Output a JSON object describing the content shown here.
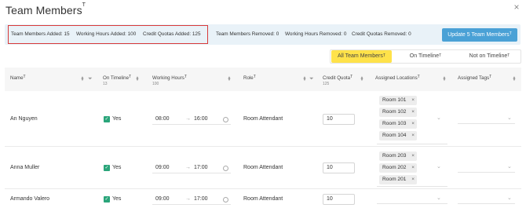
{
  "header": {
    "title": "Team Members",
    "title_mark": "T",
    "close_icon": "close-icon"
  },
  "summary": {
    "added": {
      "team_members": "Team Members Added: 15",
      "working_hours": "Working Hours Added: 100",
      "credit_quotas": "Credit Quotas Added: 125"
    },
    "removed": {
      "team_members": "Team Members Removed: 0",
      "working_hours": "Working Hours Removed: 0",
      "credit_quotas": "Credit Quotas Removed: 0"
    },
    "update_button": "Update 5 Team Members",
    "update_mark": "T",
    "highlight_color": "#d83a3a",
    "accent_color": "#4aa1d6"
  },
  "filters": {
    "tabs": [
      {
        "label": "All Team Members",
        "mark": "T",
        "active": true
      },
      {
        "label": "On Timeline",
        "mark": "T",
        "active": false
      },
      {
        "label": "Not on Timeline",
        "mark": "T",
        "active": false
      }
    ],
    "active_color": "#ffe24a"
  },
  "columns": {
    "name": {
      "label": "Name",
      "mark": "T"
    },
    "on_timeline": {
      "label": "On Timeline",
      "mark": "T",
      "sub": "13"
    },
    "working_hours": {
      "label": "Working Hours",
      "mark": "T",
      "sub": "100"
    },
    "role": {
      "label": "Role",
      "mark": "T"
    },
    "credit_quota": {
      "label": "Credit Quota",
      "mark": "T",
      "sub": "125"
    },
    "assigned_locations": {
      "label": "Assigned Locations",
      "mark": "T"
    },
    "assigned_tags": {
      "label": "Assigned Tags",
      "mark": "T"
    }
  },
  "rows": [
    {
      "name": "An Nguyen",
      "on_timeline": "Yes",
      "start": "08:00",
      "end": "16:00",
      "role": "Room Attendant",
      "quota": "10",
      "locations": [
        "Room 101",
        "Room 102",
        "Room 103",
        "Room 104"
      ]
    },
    {
      "name": "Anna Muller",
      "on_timeline": "Yes",
      "start": "09:00",
      "end": "17:00",
      "role": "Room Attendant",
      "quota": "10",
      "locations": [
        "Room 203",
        "Room 202",
        "Room 201"
      ]
    },
    {
      "name": "Armando Valero",
      "on_timeline": "Yes",
      "start": "09:00",
      "end": "17:00",
      "role": "Room Attendant",
      "quota": "10",
      "locations": []
    }
  ],
  "glyphs": {
    "arrow": "→",
    "remove": "×",
    "check": "✓",
    "chevron": "⌄",
    "close": "×"
  }
}
